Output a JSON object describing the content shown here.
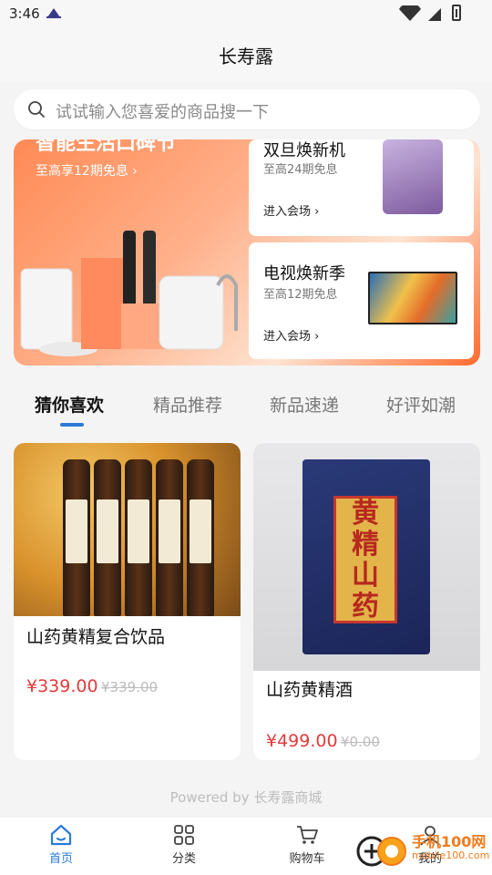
{
  "status_bar": {
    "time": "3:46"
  },
  "header": {
    "title": "长寿露"
  },
  "search": {
    "placeholder": "试试输入您喜爱的商品搜一下"
  },
  "banner": {
    "main_title": "智能生活口碑节",
    "main_sub": "至高享12期免息 ›",
    "promos": [
      {
        "title": "双旦焕新机",
        "sub": "至高24期免息",
        "enter": "进入会场 ›"
      },
      {
        "title": "电视焕新季",
        "sub": "至高12期免息",
        "enter": "进入会场 ›"
      }
    ]
  },
  "tabs": [
    {
      "label": "猜你喜欢"
    },
    {
      "label": "精品推荐"
    },
    {
      "label": "新品速递"
    },
    {
      "label": "好评如潮"
    }
  ],
  "products": [
    {
      "name": "山药黄精复合饮品",
      "price": "¥339.00",
      "old_price": "¥339.00"
    },
    {
      "name": "山药黄精酒",
      "price": "¥499.00",
      "old_price": "¥0.00",
      "box_text": [
        "黄",
        "精",
        "山",
        "药"
      ]
    }
  ],
  "footer": {
    "text": "Powered by 长寿露商城"
  },
  "nav": [
    {
      "label": "首页"
    },
    {
      "label": "分类"
    },
    {
      "label": "购物车"
    },
    {
      "label": "我的"
    }
  ],
  "watermark": {
    "text": "手机100网",
    "url": "mobile100.com"
  },
  "colors": {
    "accent": "#2a7bd8",
    "price": "#e23a3a"
  }
}
